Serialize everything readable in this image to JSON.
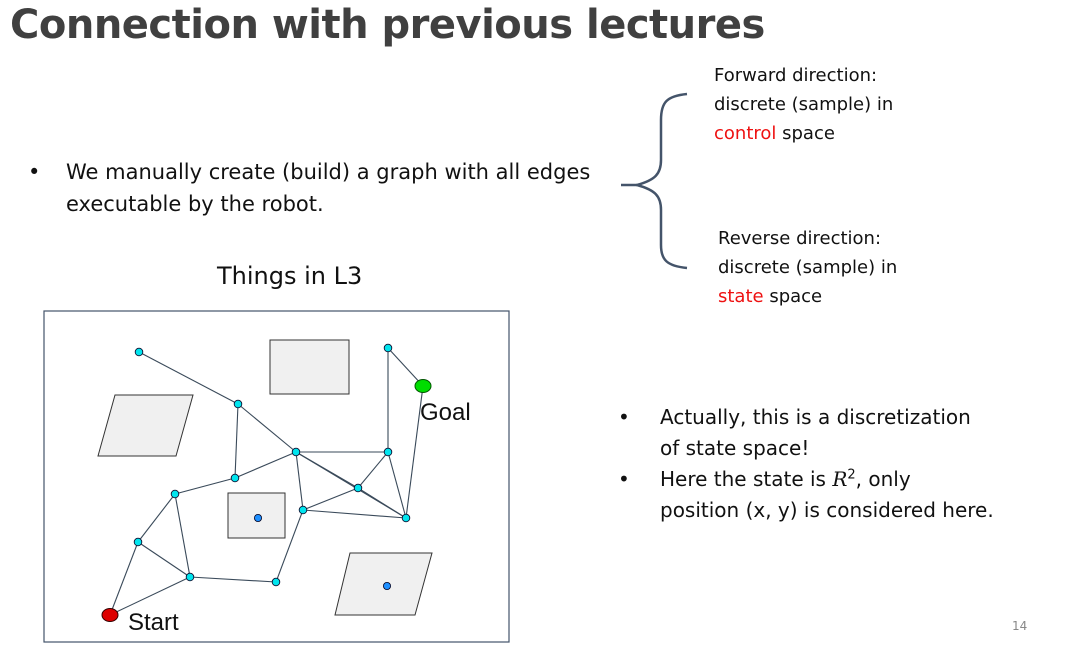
{
  "slide": {
    "title": "Connection with previous lectures",
    "page_number": "14"
  },
  "main_bullet": {
    "marker": "•",
    "line1": "We manually create (build) a graph with all edges",
    "line2": "executable by the robot."
  },
  "forward": {
    "line1": "Forward direction:",
    "line2": "discrete (sample) in",
    "highlight": "control",
    "tail": " space"
  },
  "reverse": {
    "line1": "Reverse direction:",
    "line2": "discrete (sample) in",
    "highlight": "state",
    "tail": " space"
  },
  "diagram": {
    "caption": "Things in L3",
    "goal_label": "Goal",
    "start_label": "Start"
  },
  "right_bullets": {
    "marker": "•",
    "b1_line1": "Actually, this is a discretization",
    "b1_line2": "of state space!",
    "b2_pre": "Here the state is ",
    "b2_math": "R",
    "b2_sup": "2",
    "b2_post": ", only",
    "b2_line2": "position (x, y) is considered here."
  },
  "colors": {
    "title": "#404040",
    "highlight": "#ee1111",
    "node": "#00e5ee",
    "goal": "#00dd00",
    "start": "#dd0000",
    "obstacle": "#f0f0f0",
    "obstacle_point": "#1e90ff"
  }
}
